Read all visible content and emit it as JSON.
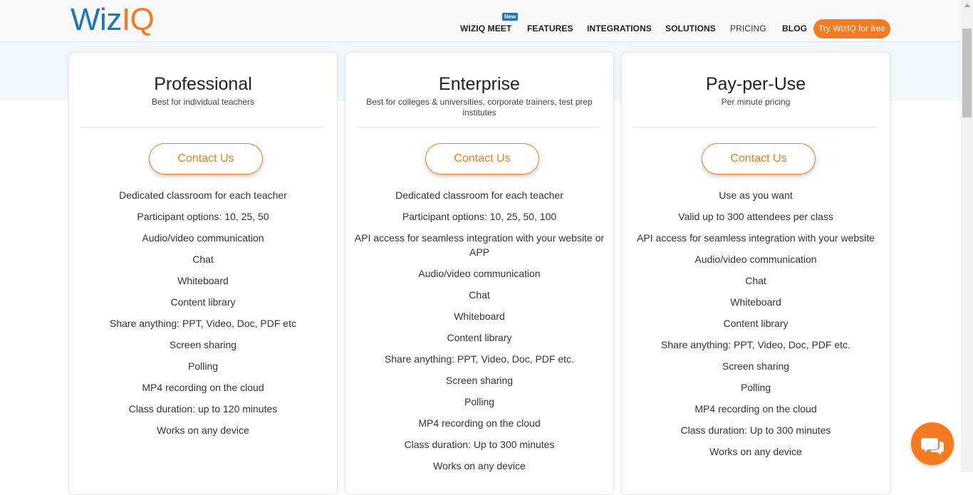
{
  "logo": {
    "wiz": "Wiz",
    "iq": "IQ"
  },
  "nav": {
    "items": [
      "WIZIQ MEET",
      "FEATURES",
      "INTEGRATIONS",
      "SOLUTIONS",
      "PRICING",
      "BLOG"
    ],
    "new_badge": "New",
    "cta": "Try WizIQ for free"
  },
  "plans": [
    {
      "title": "Professional",
      "subtitle": "Best for individual teachers",
      "button": "Contact Us",
      "features": [
        "Dedicated classroom for each teacher",
        "Participant options: 10, 25, 50",
        "Audio/video communication",
        "Chat",
        "Whiteboard",
        "Content library",
        "Share anything: PPT, Video, Doc, PDF etc",
        "Screen sharing",
        "Polling",
        "MP4 recording on the cloud",
        "Class duration: up to 120 minutes",
        "Works on any device"
      ]
    },
    {
      "title": "Enterprise",
      "subtitle": "Best for colleges & universities, corporate trainers, test prep institutes",
      "button": "Contact Us",
      "features": [
        "Dedicated classroom for each teacher",
        "Participant options: 10, 25, 50, 100",
        "API access for seamless integration with your website or APP",
        "Audio/video communication",
        "Chat",
        "Whiteboard",
        "Content library",
        "Share anything: PPT, Video, Doc, PDF etc.",
        "Screen sharing",
        "Polling",
        "MP4 recording on the cloud",
        "Class duration: Up to 300 minutes",
        "Works on any device"
      ]
    },
    {
      "title": "Pay-per-Use",
      "subtitle": "Per minute pricing",
      "button": "Contact Us",
      "features": [
        "Use as you want",
        "Valid up to 300 attendees per class",
        "API access for seamless integration with your website",
        "Audio/video communication",
        "Chat",
        "Whiteboard",
        "Content library",
        "Share anything: PPT, Video, Doc, PDF etc.",
        "Screen sharing",
        "Polling",
        "MP4 recording on the cloud",
        "Class duration: Up to 300 minutes",
        "Works on any device"
      ]
    }
  ],
  "colors": {
    "accent": "#f47b20",
    "brand_blue": "#1b75bb"
  },
  "icons": {
    "chat_widget": "chat-bubbles-icon"
  }
}
